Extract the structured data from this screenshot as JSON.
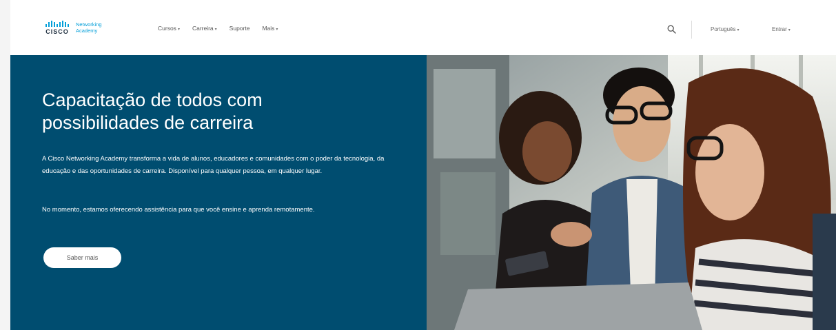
{
  "logo": {
    "wordmark": "CISCO",
    "line1": "Networking",
    "line2": "Academy"
  },
  "nav": {
    "items": [
      {
        "label": "Cursos",
        "has_dropdown": true
      },
      {
        "label": "Carreira",
        "has_dropdown": true
      },
      {
        "label": "Suporte",
        "has_dropdown": false
      },
      {
        "label": "Mais",
        "has_dropdown": true
      }
    ],
    "dropdown_caret": "▾"
  },
  "header_right": {
    "search_icon": "search-icon",
    "language": "Português",
    "login": "Entrar"
  },
  "hero": {
    "title": "Capacitação de todos com possibilidades de carreira",
    "paragraph1": "A Cisco Networking Academy transforma a vida de alunos, educadores e comunidades com o poder da tecnologia, da educação e das oportunidades de carreira. Disponível para qualquer pessoa, em qualquer lugar.",
    "paragraph2": "No momento, estamos oferecendo assistência para que você ensine e aprenda remotamente.",
    "cta_label": "Saber mais"
  },
  "colors": {
    "hero_background": "#004d70",
    "cisco_blue": "#049fd9",
    "header_background": "#ffffff"
  }
}
